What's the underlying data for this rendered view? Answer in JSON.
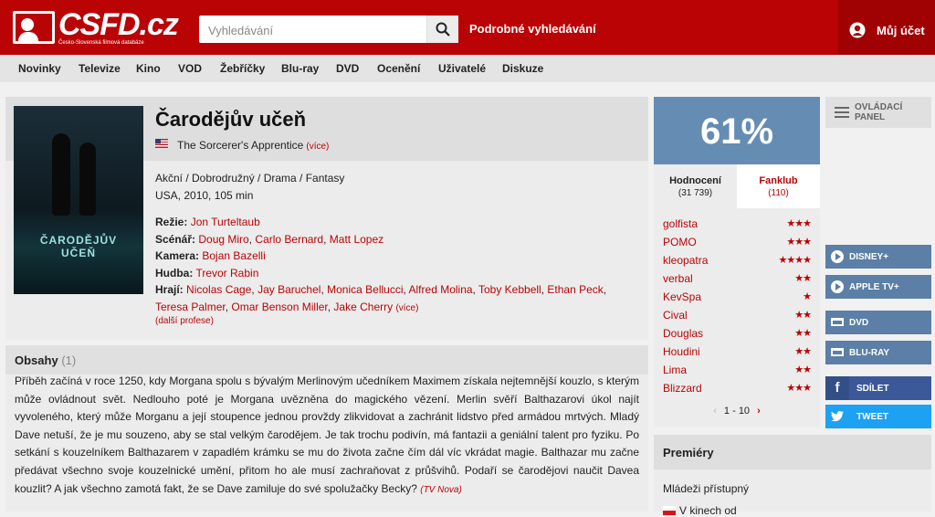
{
  "header": {
    "logo_text": "CSFD.cz",
    "logo_subtitle": "Česko-Slovenská filmová databáze",
    "search_placeholder": "Vyhledávání",
    "advanced_search": "Podrobné vyhledávání",
    "account": "Můj účet",
    "accent": "#ba0305"
  },
  "nav": [
    "Novinky",
    "Televize",
    "Kino",
    "VOD",
    "Žebříčky",
    "Blu-ray",
    "DVD",
    "Ocenění",
    "Uživatelé",
    "Diskuze"
  ],
  "movie": {
    "title": "Čarodějův učeň",
    "original_title": "The Sorcerer's Apprentice",
    "original_more": "(více)",
    "genres": "Akční / Dobrodružný / Drama / Fantasy",
    "origin": "USA, 2010, 105 min",
    "poster_text": "ČARODĚJŮV UČEŇ",
    "credits": {
      "directed_label": "Režie:",
      "directed": [
        "Jon Turteltaub"
      ],
      "written_label": "Scénář:",
      "written": [
        "Doug Miro",
        "Carlo Bernard",
        "Matt Lopez"
      ],
      "camera_label": "Kamera:",
      "camera": [
        "Bojan Bazelli"
      ],
      "music_label": "Hudba:",
      "music": [
        "Trevor Rabin"
      ],
      "cast_label": "Hrají:",
      "cast": [
        "Nicolas Cage",
        "Jay Baruchel",
        "Monica Bellucci",
        "Alfred Molina",
        "Toby Kebbell",
        "Ethan Peck",
        "Teresa Palmer",
        "Omar Benson Miller",
        "Jake Cherry"
      ],
      "cast_more": "(více)"
    },
    "more_professions": "(další profese)"
  },
  "plot": {
    "title": "Obsahy",
    "count": "(1)",
    "text": "Příběh začíná v roce 1250, kdy Morgana spolu s bývalým Merlinovým učedníkem Maximem získala nejtemnější kouzlo, s kterým může ovládnout svět. Nedlouho poté je Morgana uvězněna do magického vězení. Merlin svěří Balthazarovi úkol najít vyvoleného, který může Morganu a její stoupence jednou provždy zlikvidovat a zachránit lidstvo před armádou mrtvých. Mladý Dave netuší, že je mu souzeno, aby se stal velkým čarodějem. Je tak trochu podivín, má fantazii a geniální talent pro fyziku. Po setkání s kouzelníkem Balthazarem v zapadlém krámku se mu do života začne čím dál víc vkrádat magie. Balthazar mu začne předávat všechno svoje kouzelnické umění, přitom ho ale musí zachraňovat z průšvihů. Podaří se čarodějovi naučit Davea kouzlit? A jak všechno zamotá fakt, že se Dave zamiluje do své spolužačky Becky?",
    "source": "(TV Nova)"
  },
  "rating": {
    "percent": "61%",
    "color": "#658db4",
    "tab_ratings_label": "Hodnocení",
    "tab_ratings_count": "(31 739)",
    "tab_fanclub_label": "Fanklub",
    "tab_fanclub_count": "(110)",
    "users": [
      {
        "name": "golfista",
        "stars": "★★★"
      },
      {
        "name": "POMO",
        "stars": "★★★"
      },
      {
        "name": "kleopatra",
        "stars": "★★★★"
      },
      {
        "name": "verbal",
        "stars": "★★"
      },
      {
        "name": "KevSpa",
        "stars": "★"
      },
      {
        "name": "Cival",
        "stars": "★★"
      },
      {
        "name": "Douglas",
        "stars": "★★"
      },
      {
        "name": "Houdini",
        "stars": "★★"
      },
      {
        "name": "Lima",
        "stars": "★★"
      },
      {
        "name": "Blizzard",
        "stars": "★★★"
      }
    ],
    "pager": "1 - 10"
  },
  "premieres": {
    "title": "Premiéry",
    "age": "Mládeži přístupný",
    "cinema": "V kinech od"
  },
  "side": {
    "panel": "OVLÁDACÍ PANEL",
    "buttons": [
      {
        "label": "DISNEY+",
        "color": "#5b7fa6",
        "icon": "play-icon"
      },
      {
        "label": "APPLE TV+",
        "color": "#5b7fa6",
        "icon": "play-icon"
      },
      {
        "label": "DVD",
        "color": "#5b7fa6",
        "icon": "cart-icon"
      },
      {
        "label": "BLU-RAY",
        "color": "#5b7fa6",
        "icon": "cart-icon"
      }
    ],
    "share": "SDÍLET",
    "share_color": "#3b5998",
    "tweet": "TWEET",
    "tweet_color": "#1da1f2"
  }
}
